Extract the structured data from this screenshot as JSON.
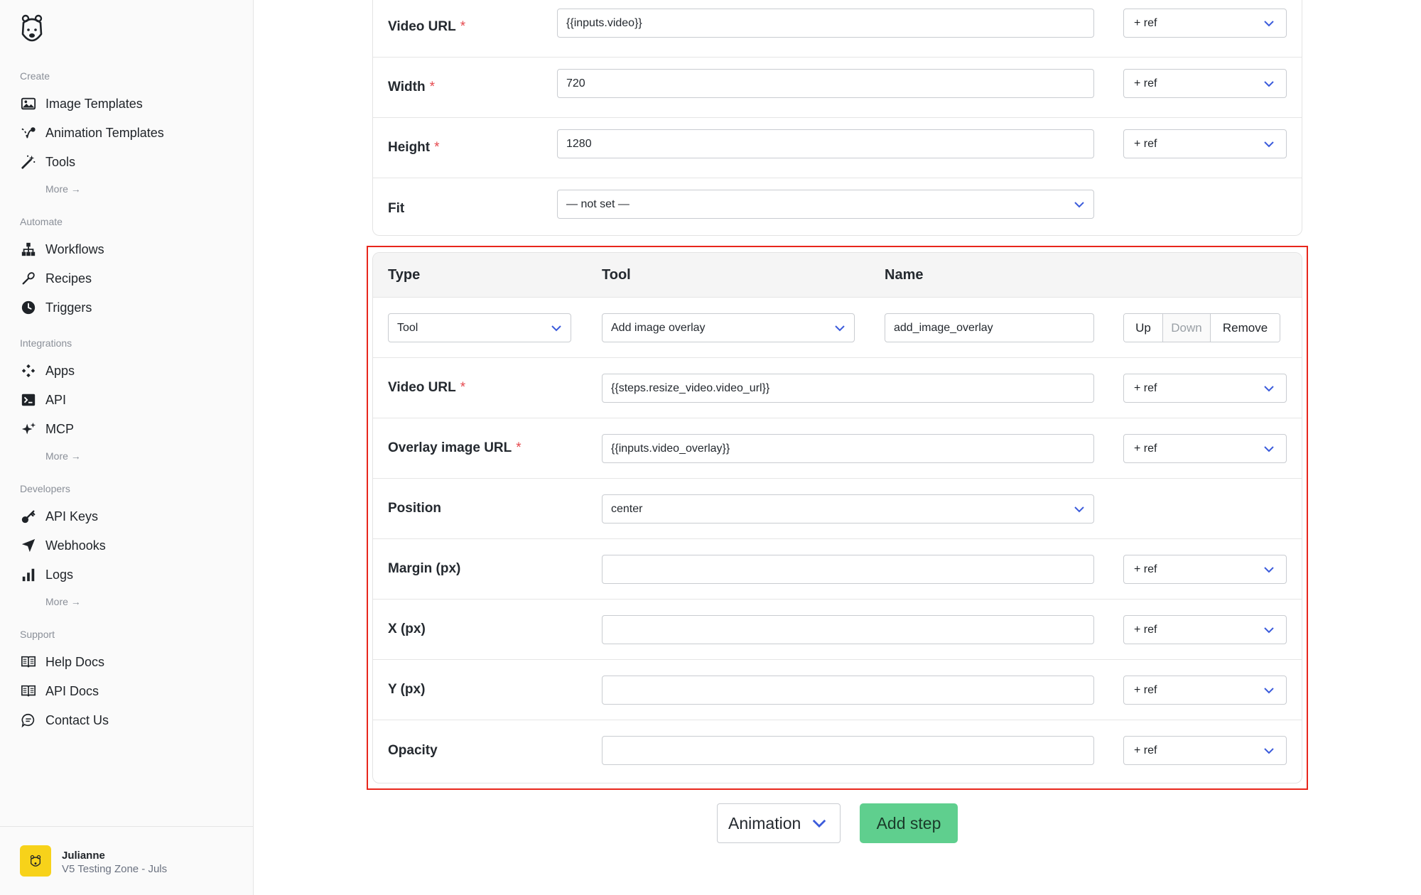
{
  "sidebar": {
    "sections": [
      {
        "title": "Create",
        "items": [
          {
            "label": "Image Templates",
            "icon": "image-icon"
          },
          {
            "label": "Animation Templates",
            "icon": "animation-icon"
          },
          {
            "label": "Tools",
            "icon": "magic-wand-icon"
          }
        ],
        "more": "More →"
      },
      {
        "title": "Automate",
        "items": [
          {
            "label": "Workflows",
            "icon": "workflow-icon"
          },
          {
            "label": "Recipes",
            "icon": "recipe-icon"
          },
          {
            "label": "Triggers",
            "icon": "clock-icon"
          }
        ]
      },
      {
        "title": "Integrations",
        "items": [
          {
            "label": "Apps",
            "icon": "apps-icon"
          },
          {
            "label": "API",
            "icon": "terminal-icon"
          },
          {
            "label": "MCP",
            "icon": "sparkle-icon"
          }
        ],
        "more": "More →"
      },
      {
        "title": "Developers",
        "items": [
          {
            "label": "API Keys",
            "icon": "key-icon"
          },
          {
            "label": "Webhooks",
            "icon": "send-icon"
          },
          {
            "label": "Logs",
            "icon": "bar-chart-icon"
          }
        ],
        "more": "More →"
      },
      {
        "title": "Support",
        "items": [
          {
            "label": "Help Docs",
            "icon": "book-icon"
          },
          {
            "label": "API Docs",
            "icon": "book-icon"
          },
          {
            "label": "Contact Us",
            "icon": "chat-icon"
          }
        ]
      }
    ],
    "user": {
      "name": "Julianne",
      "workspace": "V5 Testing Zone - Juls"
    }
  },
  "prev_step": {
    "fields": [
      {
        "label": "Video URL",
        "required": true,
        "value": "{{inputs.video}}",
        "ref": "+ ref"
      },
      {
        "label": "Width",
        "required": true,
        "value": "720",
        "ref": "+ ref"
      },
      {
        "label": "Height",
        "required": true,
        "value": "1280",
        "ref": "+ ref"
      },
      {
        "label": "Fit",
        "required": false,
        "value": "— not set —"
      }
    ]
  },
  "step": {
    "headers": {
      "type": "Type",
      "tool": "Tool",
      "name": "Name"
    },
    "type_value": "Tool",
    "tool_value": "Add image overlay",
    "name_value": "add_image_overlay",
    "buttons": {
      "up": "Up",
      "down": "Down",
      "remove": "Remove"
    },
    "fields": [
      {
        "label": "Video URL",
        "required": true,
        "value": "{{steps.resize_video.video_url}}",
        "ref": "+ ref"
      },
      {
        "label": "Overlay image URL",
        "required": true,
        "value": "{{inputs.video_overlay}}",
        "ref": "+ ref"
      },
      {
        "label": "Position",
        "required": false,
        "value": "center"
      },
      {
        "label": "Margin (px)",
        "required": false,
        "value": "",
        "ref": "+ ref"
      },
      {
        "label": "X (px)",
        "required": false,
        "value": "",
        "ref": "+ ref"
      },
      {
        "label": "Y (px)",
        "required": false,
        "value": "",
        "ref": "+ ref"
      },
      {
        "label": "Opacity",
        "required": false,
        "value": "",
        "ref": "+ ref"
      }
    ]
  },
  "footer": {
    "step_type": "Animation",
    "add_step": "Add step"
  },
  "colors": {
    "accent": "#3b5bdb",
    "required": "#e5484d",
    "add_step": "#5fcf8e",
    "highlight": "#e8261b"
  },
  "req_mark": "*"
}
